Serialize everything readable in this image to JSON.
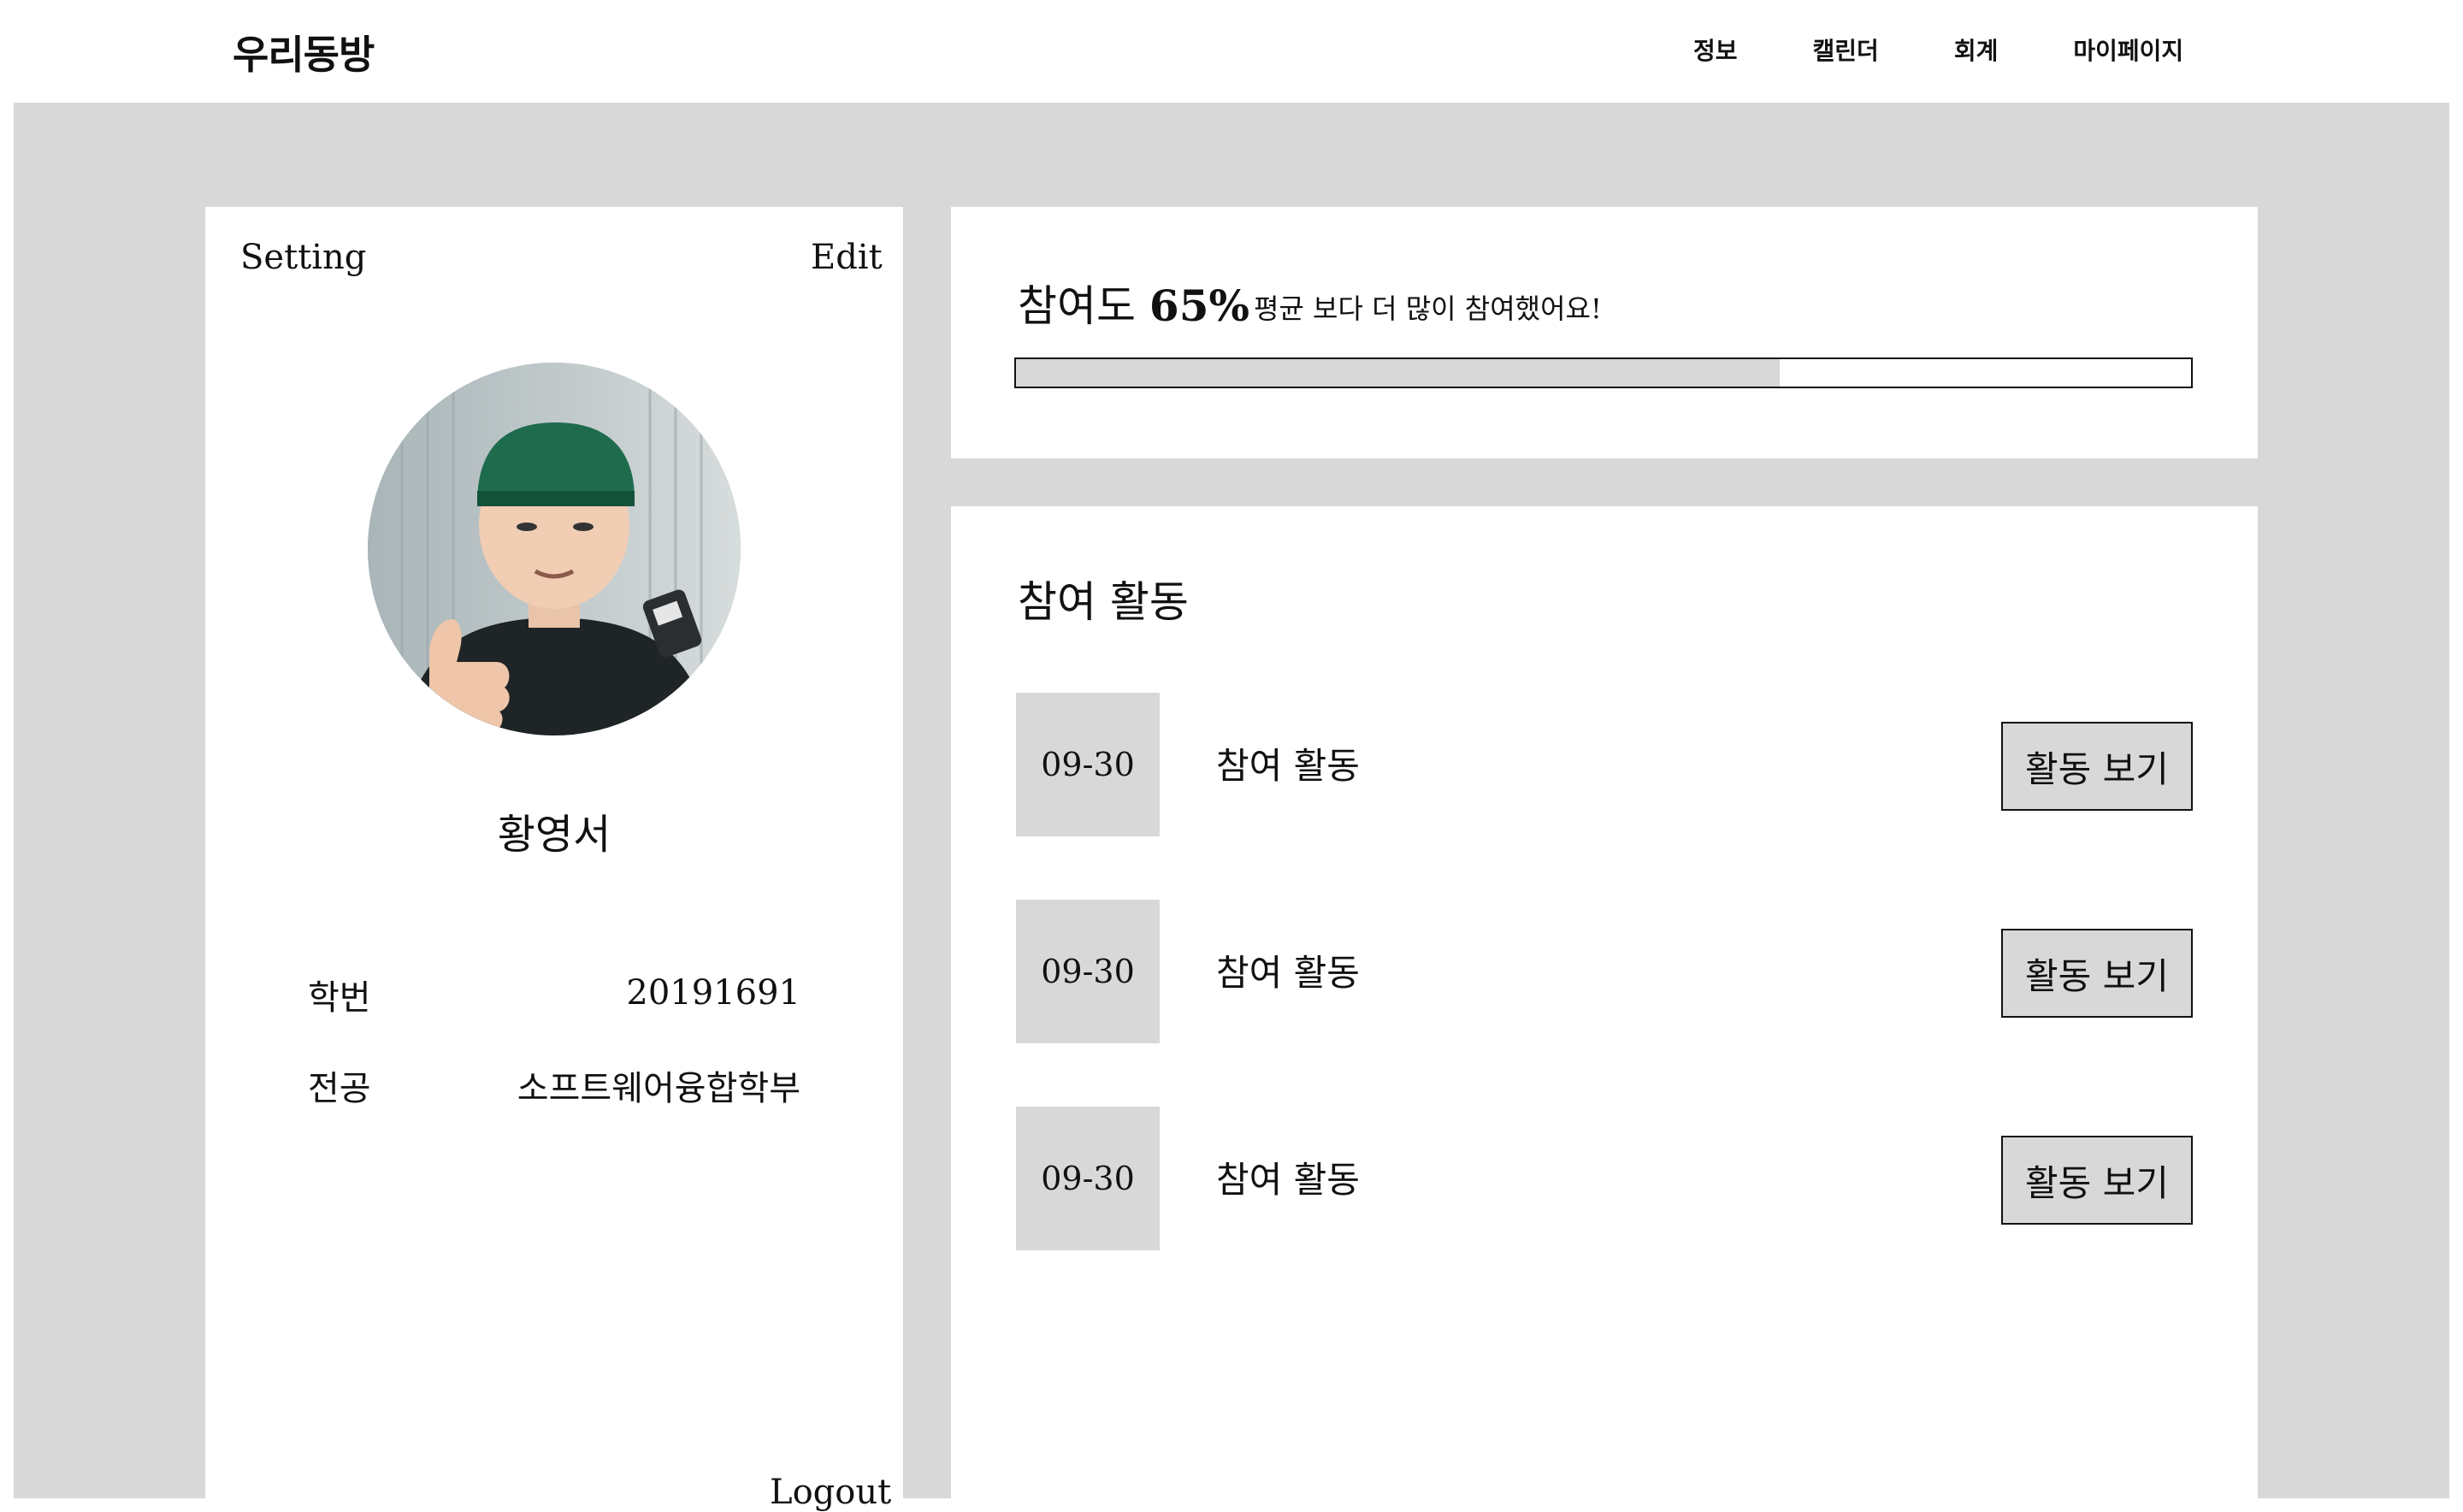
{
  "header": {
    "logo": "우리동방",
    "nav": [
      "정보",
      "캘린더",
      "회계",
      "마이페이지"
    ]
  },
  "profile": {
    "setting_label": "Setting",
    "edit_label": "Edit",
    "name": "황영서",
    "student_id_label": "학번",
    "student_id": "20191691",
    "major_label": "전공",
    "major": "소프트웨어융합학부",
    "logout_label": "Logout"
  },
  "participation": {
    "title": "참여도",
    "percent_text": "65%",
    "percent": 65,
    "subtitle": "평균 보다 더 많이 참여했어요!"
  },
  "activities": {
    "title": "참여 활동",
    "items": [
      {
        "date": "09-30",
        "label": "참여 활동",
        "button": "활동 보기"
      },
      {
        "date": "09-30",
        "label": "참여 활동",
        "button": "활동 보기"
      },
      {
        "date": "09-30",
        "label": "참여 활동",
        "button": "활동 보기"
      }
    ]
  },
  "colors": {
    "panel_bg": "#d8d8d8",
    "card_bg": "#ffffff",
    "text": "#111111"
  }
}
